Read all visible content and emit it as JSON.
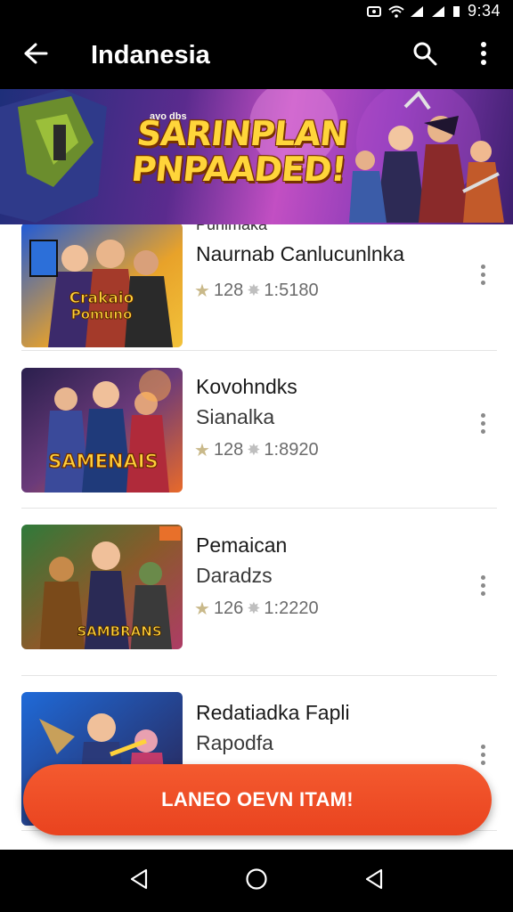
{
  "status_bar": {
    "time": "9:34"
  },
  "app_bar": {
    "title": "Indanesia"
  },
  "banner": {
    "title_line1": "SARINPLAN",
    "title_line2": "PNPAADED!",
    "small_text": "ayo dbs"
  },
  "items": [
    {
      "overline": "Punimaka",
      "title": "Naurnab Canlucunlnka",
      "subtitle": "",
      "rating": "128",
      "count": "1:5180",
      "thumb_text": "Crakaio Pomuno"
    },
    {
      "title": "Kovohndks",
      "subtitle": "Sianalka",
      "rating": "128",
      "count": "1:8920",
      "thumb_text": "SAMENAIS"
    },
    {
      "title": "Pemaican",
      "subtitle": "Daradzs",
      "rating": "126",
      "count": "1:2220",
      "thumb_text": "SAMBRANS"
    },
    {
      "title": "Redatiadka Fapli",
      "subtitle": "Rapodfa",
      "rating": "",
      "count": "",
      "thumb_text": ""
    }
  ],
  "cta": {
    "label": "LANEO OEVN ITAM!"
  },
  "icons": {
    "back": "back-arrow-icon",
    "search": "search-icon",
    "more": "more-vert-icon",
    "nav_back": "nav-back-icon",
    "nav_home": "nav-home-icon",
    "nav_recents": "nav-recents-icon"
  },
  "colors": {
    "accent": "#ef4d25",
    "appbar": "#000000",
    "star": "#c9b98a"
  }
}
